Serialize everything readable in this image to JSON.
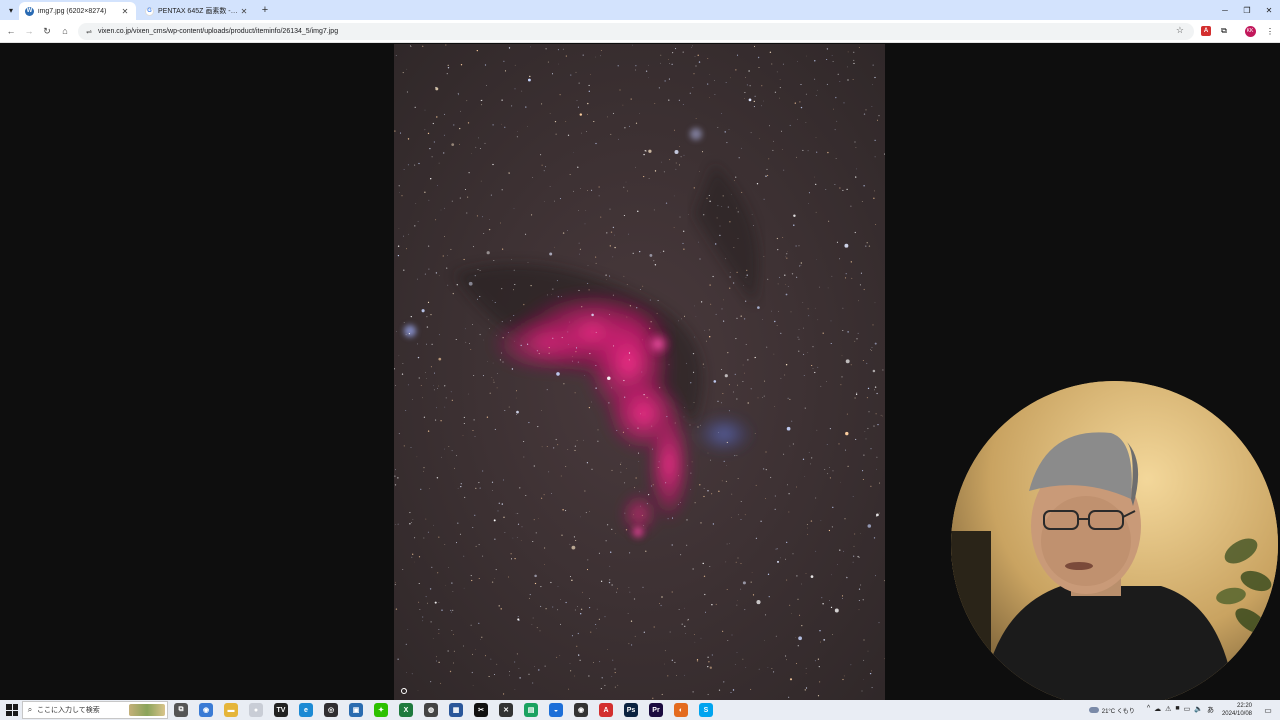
{
  "browser": {
    "tabs": [
      {
        "title": "img7.jpg (6202×8274)",
        "favicon": "wordpress-icon",
        "active": true
      },
      {
        "title": "PENTAX 645Z 画素数 - Google",
        "favicon": "google-icon",
        "active": false
      }
    ],
    "new_tab_glyph": "+",
    "window_controls": {
      "minimize": "─",
      "restore": "❐",
      "close": "✕"
    },
    "nav": {
      "back": "←",
      "forward": "→",
      "reload": "↻",
      "home": "⌂"
    },
    "url": "vixen.co.jp/vixen_cms/wp-content/uploads/product/iteminfo/26134_5/img7.jpg",
    "bookmark_star": "☆",
    "extension_pdf": "A",
    "profile_initials": "KK",
    "menu": "⋮"
  },
  "content": {
    "image_kind": "astrophotography-seagull-nebula",
    "background": "#0e0e0e",
    "nebula_color": "#e0267a"
  },
  "webcam": {
    "kind": "webcam-overlay"
  },
  "taskbar": {
    "search_placeholder": "ここに入力して検索",
    "apps": [
      {
        "name": "task-view",
        "glyph": "⧉",
        "color": "#555555"
      },
      {
        "name": "copilot",
        "glyph": "◉",
        "color": "#3a7bd5"
      },
      {
        "name": "file-explorer",
        "glyph": "▬",
        "color": "#e5b53a"
      },
      {
        "name": "chrome",
        "glyph": "●",
        "color": "#db4437"
      },
      {
        "name": "app-tv",
        "glyph": "TV",
        "color": "#222222"
      },
      {
        "name": "edge",
        "glyph": "e",
        "color": "#1c8ad4"
      },
      {
        "name": "obs",
        "glyph": "◎",
        "color": "#302e31"
      },
      {
        "name": "store",
        "glyph": "▣",
        "color": "#2b6cb0"
      },
      {
        "name": "wechat",
        "glyph": "✦",
        "color": "#2dc100"
      },
      {
        "name": "excel",
        "glyph": "X",
        "color": "#1f7a3e"
      },
      {
        "name": "app-disc",
        "glyph": "◍",
        "color": "#444444"
      },
      {
        "name": "app-blue",
        "glyph": "▦",
        "color": "#2b579a"
      },
      {
        "name": "capcut",
        "glyph": "✂",
        "color": "#111111"
      },
      {
        "name": "app-x",
        "glyph": "✕",
        "color": "#333333"
      },
      {
        "name": "app-green",
        "glyph": "▤",
        "color": "#1aa260"
      },
      {
        "name": "app-chat",
        "glyph": "◒",
        "color": "#1d6fd8"
      },
      {
        "name": "app-circle",
        "glyph": "◉",
        "color": "#333333"
      },
      {
        "name": "acrobat",
        "glyph": "A",
        "color": "#d32f2f"
      },
      {
        "name": "photoshop",
        "glyph": "Ps",
        "color": "#0b2240"
      },
      {
        "name": "premiere",
        "glyph": "Pr",
        "color": "#1b0b40"
      },
      {
        "name": "app-orange",
        "glyph": "◐",
        "color": "#e46b1f"
      },
      {
        "name": "skype",
        "glyph": "S",
        "color": "#00a4ef"
      }
    ],
    "weather": "21°C くもり",
    "tray_icons": [
      "^",
      "☁",
      "⚠",
      "■",
      "▭",
      "🔈",
      "あ"
    ],
    "time": "22:20",
    "date": "2024/10/08",
    "notification_glyph": "▭"
  }
}
